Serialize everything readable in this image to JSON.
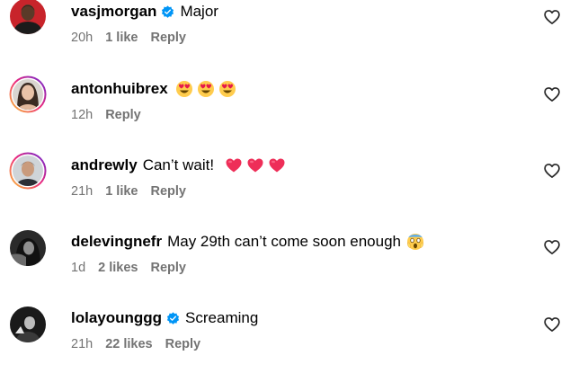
{
  "comments": [
    {
      "username": "vasjmorgan",
      "verified": true,
      "text": "Major",
      "time": "20h",
      "likes": "1 like",
      "reply": "Reply",
      "avatar_icon": "avatar-man-red-background"
    },
    {
      "username": "antonhuibrex",
      "verified": false,
      "text": "",
      "emojis": [
        "heart-eyes-emoji",
        "heart-eyes-emoji",
        "heart-eyes-emoji"
      ],
      "time": "12h",
      "likes": "",
      "reply": "Reply",
      "avatar_icon": "avatar-woman-story-ring"
    },
    {
      "username": "andrewly",
      "verified": false,
      "text": "Can’t wait!",
      "emojis": [
        "red-heart-emoji",
        "red-heart-emoji",
        "red-heart-emoji"
      ],
      "time": "21h",
      "likes": "1 like",
      "reply": "Reply",
      "avatar_icon": "avatar-man-story-ring"
    },
    {
      "username": "delevingnefr",
      "verified": false,
      "text": "May 29th can’t come soon enough",
      "emojis": [
        "screaming-face-emoji"
      ],
      "time": "1d",
      "likes": "2 likes",
      "reply": "Reply",
      "avatar_icon": "avatar-dark-photo"
    },
    {
      "username": "lolayounggg",
      "verified": true,
      "text": "Screaming",
      "time": "21h",
      "likes": "22 likes",
      "reply": "Reply",
      "avatar_icon": "avatar-black-and-white"
    }
  ],
  "colors": {
    "verified_badge": "#0095f6",
    "meta_text": "#737373",
    "story_ring_start": "#f9ce34",
    "story_ring_end": "#c13584"
  }
}
